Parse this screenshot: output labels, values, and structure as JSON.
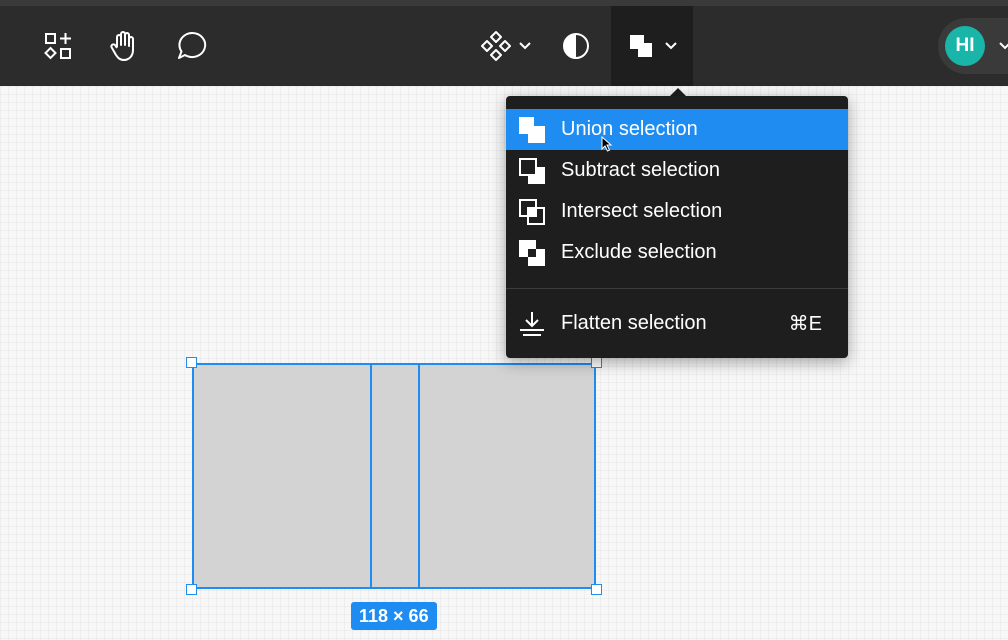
{
  "toolbar": {
    "icons": [
      "shapes-icon",
      "hand-icon",
      "comment-icon",
      "component-icon",
      "chevron-down-icon",
      "contrast-icon",
      "boolean-union-icon"
    ]
  },
  "user": {
    "initials": "HI",
    "avatar_color": "#19b5a8"
  },
  "menu": {
    "items": [
      {
        "label": "Union selection",
        "icon": "union-icon",
        "selected": true
      },
      {
        "label": "Subtract selection",
        "icon": "subtract-icon"
      },
      {
        "label": "Intersect selection",
        "icon": "intersect-icon"
      },
      {
        "label": "Exclude selection",
        "icon": "exclude-icon"
      }
    ],
    "flatten": {
      "label": "Flatten selection",
      "shortcut": "⌘E",
      "icon": "flatten-icon"
    }
  },
  "selection": {
    "dimensions": "118 × 66"
  },
  "colors": {
    "accent": "#1e8cf0",
    "toolbar": "#2c2c2c",
    "menu": "#1e1e1e"
  }
}
